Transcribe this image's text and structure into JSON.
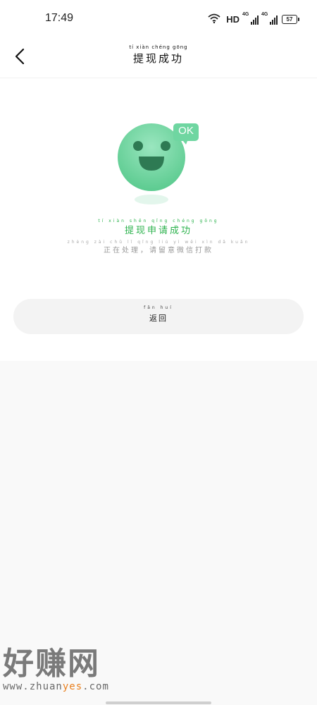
{
  "status_bar": {
    "time": "17:49",
    "network_label": "HD",
    "signal1_label": "4G",
    "signal2_label": "4G",
    "battery": "57",
    "icons": [
      "wifi-icon",
      "signal-icon",
      "signal-icon",
      "battery-icon"
    ]
  },
  "header": {
    "title": "提现成功",
    "title_pinyin": "tí  xiàn chéng gōng",
    "back_icon": "chevron-left-icon"
  },
  "illustration": {
    "badge_text": "OK",
    "face_color": "#6fd6a1",
    "accent_color": "#2bb24c"
  },
  "result": {
    "title": "提现申请成功",
    "title_pinyin": "tí xiàn shēn qǐng chéng gōng",
    "subtitle": "正在处理，请留意微信打款",
    "subtitle_pinyin": "zhèng zài chǔ lǐ qǐng liú yì wēi xìn dǎ kuǎn"
  },
  "return_button": {
    "label": "返回",
    "pinyin": "fǎn huí"
  },
  "watermark": {
    "big": "好赚网",
    "url_prefix": "www.zhuan",
    "url_accent": "yes",
    "url_suffix": ".com"
  }
}
